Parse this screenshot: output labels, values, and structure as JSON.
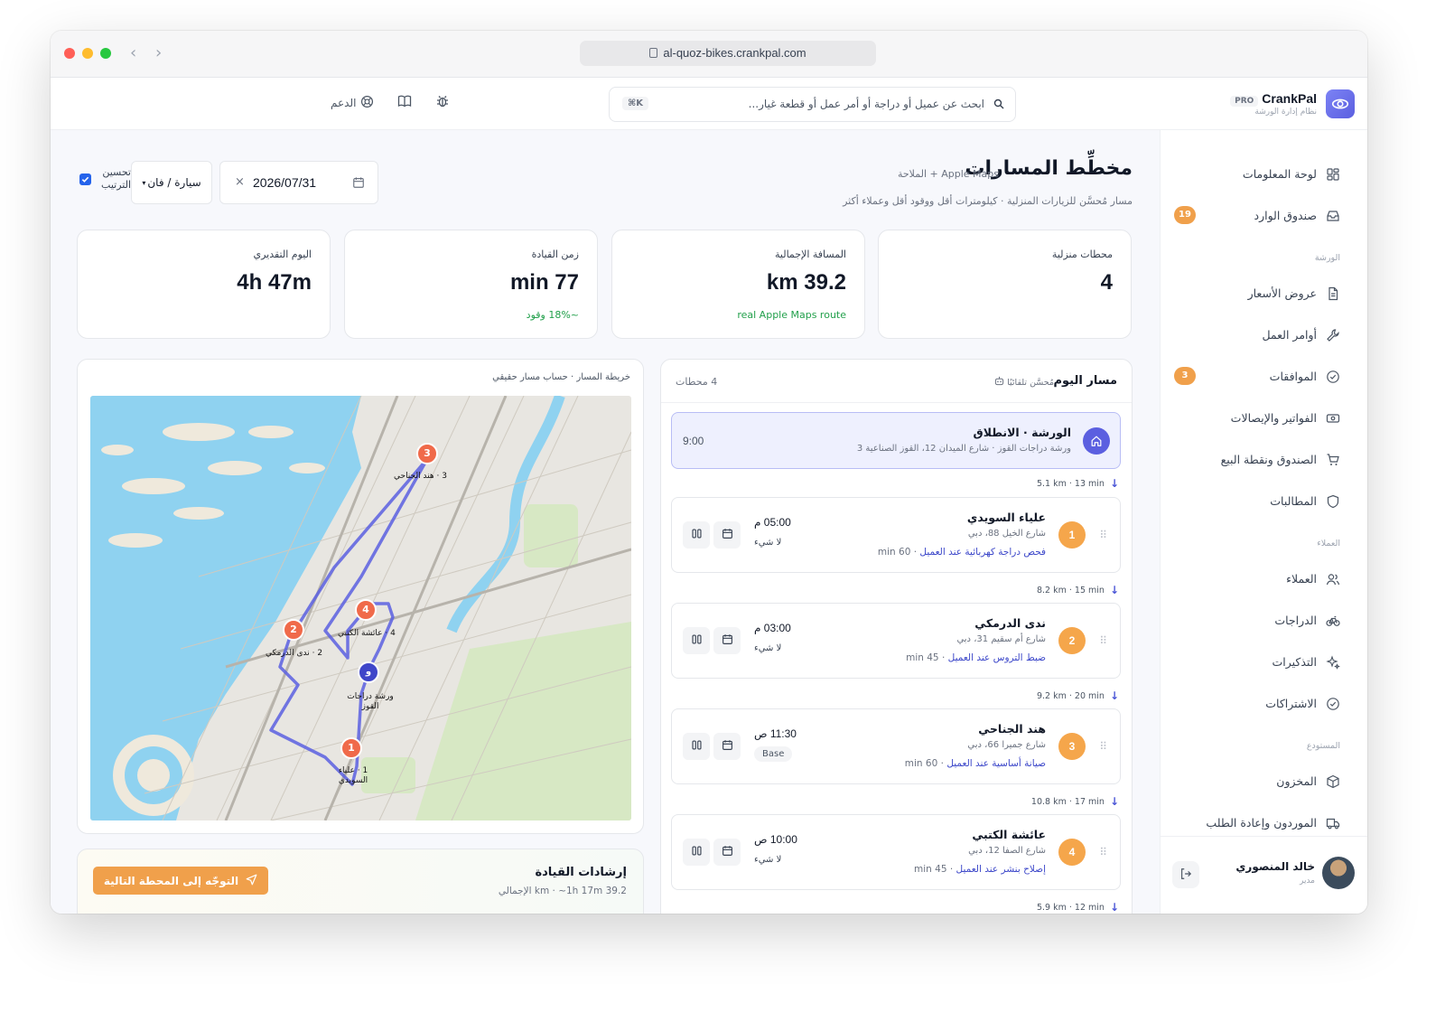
{
  "browser": {
    "url": "al-quoz-bikes.crankpal.com"
  },
  "brand": {
    "name": "CrankPal",
    "badge": "PRO",
    "subtitle": "نظام إدارة الورشة",
    "accent": "#5b5fe0"
  },
  "search": {
    "placeholder": "ابحث عن عميل أو دراجة أو أمر عمل أو قطعة غيار...",
    "shortcut": "⌘K"
  },
  "top_actions": {
    "support_label": "الدعم",
    "icons": [
      "bug-icon",
      "book-icon",
      "lifebuoy-icon"
    ]
  },
  "sidebar": {
    "items": [
      {
        "label": "لوحة المعلومات",
        "icon": "dashboard-icon"
      },
      {
        "label": "صندوق الوارد",
        "icon": "inbox-icon",
        "badge": "19"
      },
      {
        "label": "عروض الأسعار",
        "icon": "document-icon"
      },
      {
        "label": "أوامر العمل",
        "icon": "wrench-icon"
      },
      {
        "label": "الموافقات",
        "icon": "check-circle-icon",
        "badge": "3"
      },
      {
        "label": "الفواتير والإيصالات",
        "icon": "receipt-icon"
      },
      {
        "label": "الصندوق ونقطة البيع",
        "icon": "cart-icon"
      },
      {
        "label": "المطالبات",
        "icon": "shield-icon"
      },
      {
        "label": "العملاء",
        "icon": "users-icon"
      },
      {
        "label": "الدراجات",
        "icon": "bike-icon"
      },
      {
        "label": "التذكيرات",
        "icon": "sparkle-icon"
      },
      {
        "label": "الاشتراكات",
        "icon": "check-circle-icon"
      },
      {
        "label": "المخزون",
        "icon": "box-icon"
      },
      {
        "label": "الموردون وإعادة الطلب",
        "icon": "truck-icon"
      }
    ],
    "sections": [
      "الورشة",
      "العملاء",
      "المستودع"
    ],
    "user": {
      "name": "خالد المنصوري",
      "role": "مدير"
    }
  },
  "page": {
    "title": "مخطِّط المسارات",
    "tag": "Apple Maps + الملاحة",
    "subtitle": "مسار مُحسَّن للزيارات المنزلية · كيلومترات أقل ووقود أقل وعملاء أكثر"
  },
  "controls": {
    "optimize_label": "تحسين الترتيب",
    "optimize_checked": true,
    "vehicle": "سيارة / فان",
    "date": "2026/07/31"
  },
  "stats": [
    {
      "label": "محطات منزلية",
      "value": "4",
      "note": ""
    },
    {
      "label": "المسافة الإجمالية",
      "value": "km 39.2",
      "note": "real Apple Maps route"
    },
    {
      "label": "زمن القيادة",
      "value": "min 77",
      "note": "~18% وقود"
    },
    {
      "label": "اليوم التقديري",
      "value": "4h 47m",
      "note": ""
    }
  ],
  "map": {
    "caption": "خريطة المسار · حساب مسار حقيقي",
    "markers": [
      {
        "num": "3",
        "label": "3 · هند الجناحي"
      },
      {
        "num": "2",
        "label": "2 · ندى الدرمكي"
      },
      {
        "num": "4",
        "label": "4 · عائشة الكتبي"
      },
      {
        "num": "و",
        "label": "ورشة دراجات القوز"
      },
      {
        "num": "1",
        "label": "1 · علياء السويدي"
      }
    ]
  },
  "driving": {
    "title": "إرشادات القيادة",
    "summary": "39.2 km · ~1h 17m الإجمالي",
    "button": "التوجّه إلى المحطة التالية"
  },
  "route": {
    "title": "مسار اليوم",
    "auto": "مُحسَّن تلقائيًا",
    "count": "4 محطات",
    "start": {
      "name": "الورشة · الانطلاق",
      "address": "ورشة دراجات القوز · شارع الميدان 12، القوز الصناعية 3",
      "time": "9:00"
    },
    "segments": [
      "5.1 km · 13 min",
      "8.2 km · 15 min",
      "9.2 km · 20 min",
      "10.8 km · 17 min",
      "5.9 km · 12 min"
    ],
    "stops": [
      {
        "num": "1",
        "name": "علياء السويدي",
        "address": "شارع الخيل 88، دبي",
        "job": "فحص دراجة كهربائية عند العميل",
        "duration": " · 60 min",
        "time": "05:00 م",
        "note": "لا شيء"
      },
      {
        "num": "2",
        "name": "ندى الدرمكي",
        "address": "شارع أم سقيم 31، دبي",
        "job": "ضبط التروس عند العميل",
        "duration": " · 45 min",
        "time": "03:00 م",
        "note": "لا شيء"
      },
      {
        "num": "3",
        "name": "هند الجناحي",
        "address": "شارع جميرا 66، دبي",
        "job": "صيانة أساسية عند العميل",
        "duration": " · 60 min",
        "time": "11:30 ص",
        "pill": "Base"
      },
      {
        "num": "4",
        "name": "عائشة الكتبي",
        "address": "شارع الصفا 12، دبي",
        "job": "إصلاح بنشر عند العميل",
        "duration": " · 45 min",
        "time": "10:00 ص",
        "note": "لا شيء"
      }
    ]
  }
}
